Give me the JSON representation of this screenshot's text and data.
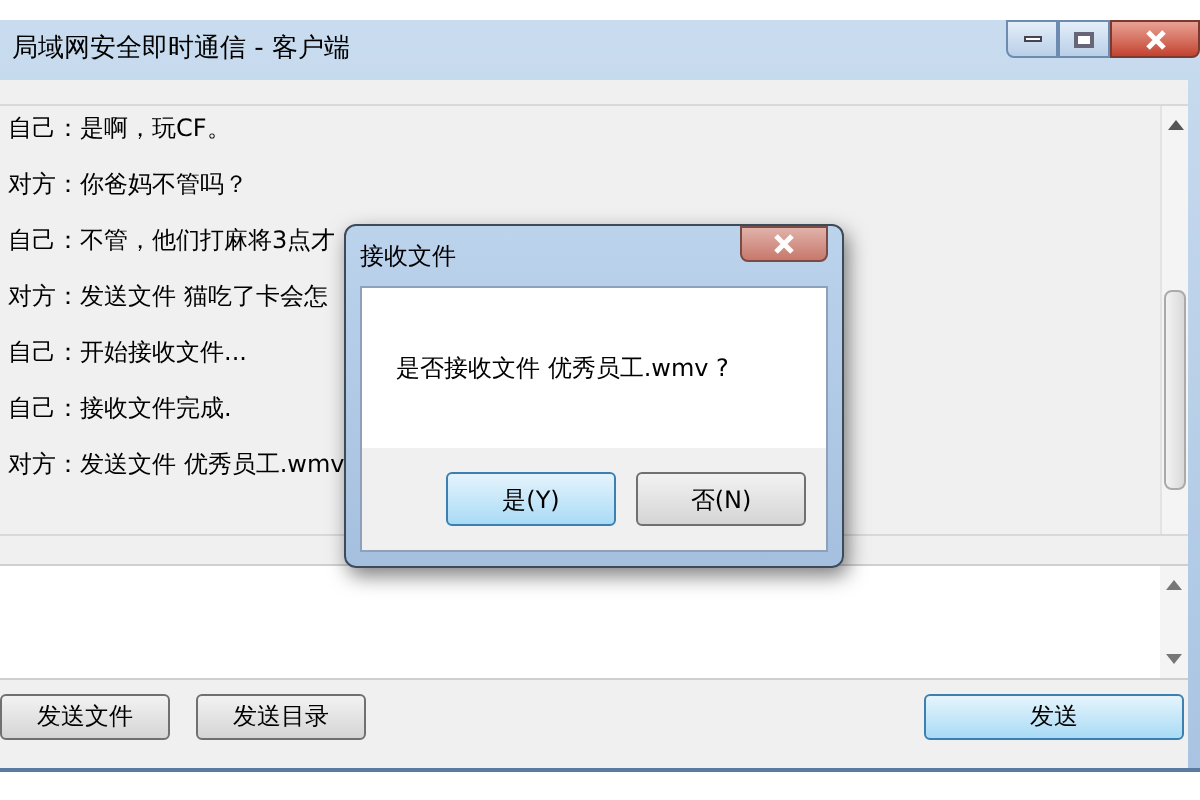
{
  "window": {
    "title": "局域网安全即时通信 - 客户端"
  },
  "messages": [
    {
      "text": "自己：是啊，玩CF。"
    },
    {
      "text": "对方：你爸妈不管吗？"
    },
    {
      "text": "自己：不管，他们打麻将3点才"
    },
    {
      "text": "对方：发送文件 猫吃了卡会怎"
    },
    {
      "text": "自己：开始接收文件..."
    },
    {
      "text": "自己：接收文件完成."
    },
    {
      "text": "对方：发送文件 优秀员工.wmv"
    }
  ],
  "buttons": [
    {
      "label": "发送文件",
      "default": false
    },
    {
      "label": "发送目录",
      "default": false
    },
    {
      "label": "发送",
      "default": true
    }
  ],
  "dialog": {
    "title": "接收文件",
    "message": "是否接收文件 优秀员工.wmv ?",
    "buttons": [
      {
        "label": "是(Y)",
        "default": true
      },
      {
        "label": "否(N)",
        "default": false
      }
    ]
  }
}
